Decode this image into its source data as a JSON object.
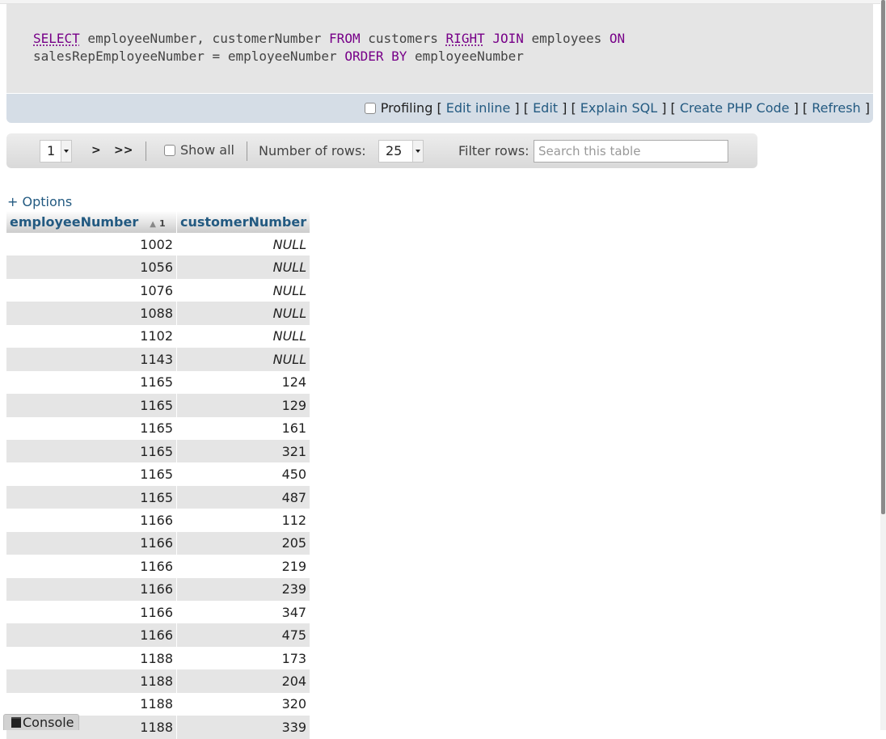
{
  "query": {
    "kw_select": "SELECT",
    "part_cols": " employeeNumber, customerNumber ",
    "kw_from": "FROM",
    "part_customers": " customers ",
    "kw_right": "RIGHT",
    "kw_join": "JOIN",
    "part_employees": " employees ",
    "kw_on": "ON",
    "part_cond": "salesRepEmployeeNumber = employeeNumber ",
    "kw_order": "ORDER BY",
    "part_order": " employeeNumber"
  },
  "actions": {
    "profiling_label": "Profiling",
    "edit_inline": "Edit inline",
    "edit": "Edit",
    "explain_sql": "Explain SQL",
    "create_php": "Create PHP Code",
    "refresh": "Refresh"
  },
  "nav": {
    "page_value": "1",
    "next": ">",
    "last": ">>",
    "show_all": "Show all",
    "rows_label": "Number of rows:",
    "rows_value": "25",
    "filter_label": "Filter rows:",
    "filter_placeholder": "Search this table"
  },
  "options_link": "+ Options",
  "table": {
    "columns": [
      "employeeNumber",
      "customerNumber"
    ],
    "sort_index": "1",
    "rows": [
      [
        "1002",
        "NULL"
      ],
      [
        "1056",
        "NULL"
      ],
      [
        "1076",
        "NULL"
      ],
      [
        "1088",
        "NULL"
      ],
      [
        "1102",
        "NULL"
      ],
      [
        "1143",
        "NULL"
      ],
      [
        "1165",
        "124"
      ],
      [
        "1165",
        "129"
      ],
      [
        "1165",
        "161"
      ],
      [
        "1165",
        "321"
      ],
      [
        "1165",
        "450"
      ],
      [
        "1165",
        "487"
      ],
      [
        "1166",
        "112"
      ],
      [
        "1166",
        "205"
      ],
      [
        "1166",
        "219"
      ],
      [
        "1166",
        "239"
      ],
      [
        "1166",
        "347"
      ],
      [
        "1166",
        "475"
      ],
      [
        "1188",
        "173"
      ],
      [
        "1188",
        "204"
      ],
      [
        "1188",
        "320"
      ],
      [
        "1188",
        "339"
      ]
    ]
  },
  "console_label": "Console"
}
